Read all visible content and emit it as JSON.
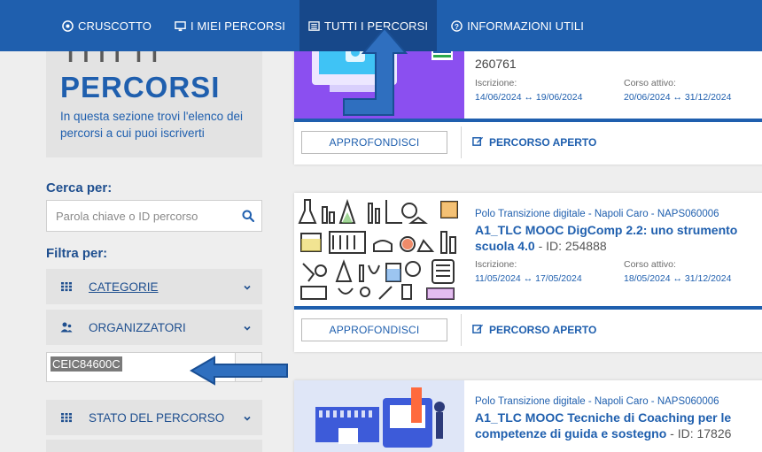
{
  "nav": {
    "items": [
      {
        "label": "CRUSCOTTO",
        "icon": "dashboard-icon"
      },
      {
        "label": "I MIEI PERCORSI",
        "icon": "monitor-icon"
      },
      {
        "label": "TUTTI I PERCORSI",
        "icon": "list-icon"
      },
      {
        "label": "INFORMAZIONI UTILI",
        "icon": "help-icon"
      }
    ]
  },
  "hero": {
    "top_word": "TUTTI",
    "title": "PERCORSI",
    "description": "In questa sezione trovi l'elenco dei percorsi a cui puoi iscriverti"
  },
  "search": {
    "label": "Cerca per:",
    "placeholder": "Parola chiave o ID percorso"
  },
  "filters": {
    "label": "Filtra per:",
    "categorie": "CATEGORIE",
    "organizzatori": "ORGANIZZATORI",
    "organizzatori_value": "CEIC84600C",
    "stato": "STATO DEL PERCORSO"
  },
  "cards": [
    {
      "org_line": "",
      "title": "",
      "course_id": "260761",
      "iscrizione_label": "Iscrizione:",
      "iscrizione": "14/06/2024 ↔ 19/06/2024",
      "attivo_label": "Corso attivo:",
      "attivo": "20/06/2024 ↔ 31/12/2024",
      "more": "APPROFONDISCI",
      "status": "PERCORSO APERTO"
    },
    {
      "org_line": "Polo Transizione digitale - Napoli Caro - NAPS060006",
      "title1": "A1_TLC MOOC DigComp 2.2: uno strumento",
      "title2": "scuola 4.0",
      "id_text": " - ID: 254888",
      "iscrizione_label": "Iscrizione:",
      "iscrizione": "11/05/2024 ↔ 17/05/2024",
      "attivo_label": "Corso attivo:",
      "attivo": "18/05/2024 ↔ 31/12/2024",
      "more": "APPROFONDISCI",
      "status": "PERCORSO APERTO"
    },
    {
      "org_line": "Polo Transizione digitale - Napoli Caro - NAPS060006",
      "title1": "A1_TLC MOOC Tecniche di Coaching per le",
      "title2": "competenze di guida e sostegno",
      "id_text": " - ID: 17826"
    }
  ],
  "colors": {
    "brand": "#1f5fae",
    "nav_active": "#17488a",
    "arrow": "#2f6fbf"
  }
}
